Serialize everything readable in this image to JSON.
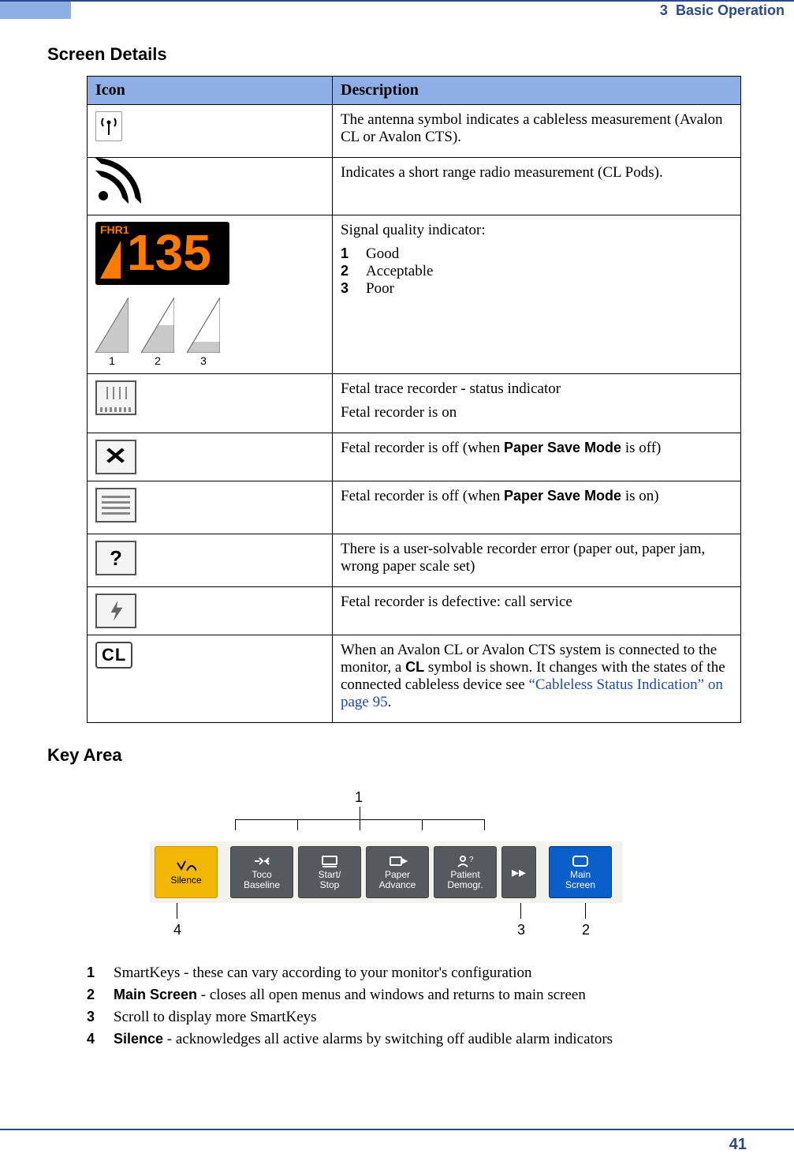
{
  "header": {
    "chapter": "3",
    "chapter_title": "Basic Operation"
  },
  "sections": {
    "screen_details": "Screen Details",
    "key_area": "Key Area"
  },
  "table": {
    "head": {
      "icon": "Icon",
      "desc": "Description"
    },
    "rows": {
      "antenna": "The antenna symbol indicates a cableless measurement (Avalon CL or Avalon CTS).",
      "rss": "Indicates a short range radio measurement (CL Pods).",
      "signal": {
        "title": "Signal quality indicator:",
        "items": {
          "1": "Good",
          "2": "Acceptable",
          "3": "Poor"
        },
        "fhr_label": "FHR1",
        "fhr_value": "135",
        "bar_labels": {
          "1": "1",
          "2": "2",
          "3": "3"
        }
      },
      "rec_on": {
        "l1": "Fetal trace recorder - status indicator",
        "l2": "Fetal recorder is on"
      },
      "rec_off_psm_off": {
        "pre": "Fetal recorder is off (when ",
        "code": "Paper Save Mode",
        "post": " is off)"
      },
      "rec_off_psm_on": {
        "pre": "Fetal recorder is off (when ",
        "code": "Paper Save Mode",
        "post": " is on)"
      },
      "rec_err": "There is a user-solvable recorder error (paper out, paper jam, wrong paper scale set)",
      "rec_def": "Fetal recorder is defective: call service",
      "cl": {
        "pre": "When an Avalon CL or Avalon CTS system is connected to the monitor, a ",
        "code": "CL",
        "mid": " symbol is shown. It changes with the states of the connected cableless device see ",
        "link": "“Cableless Status Indication” on page 95",
        "post": ".",
        "chip": "CL"
      }
    }
  },
  "keyarea": {
    "callouts": {
      "c1": "1",
      "c2": "2",
      "c3": "3",
      "c4": "4"
    },
    "keys": {
      "silence": "Silence",
      "toco": "Toco\nBaseline",
      "startstop": "Start/\nStop",
      "paper": "Paper\nAdvance",
      "patient": "Patient\nDemogr.",
      "main": "Main\nScreen"
    },
    "list": {
      "r1": {
        "n": "1",
        "t": "SmartKeys - these can vary according to your monitor's configuration"
      },
      "r2": {
        "n": "2",
        "code": "Main Screen",
        "t": " - closes all open menus and windows and returns to main screen"
      },
      "r3": {
        "n": "3",
        "t": "Scroll to display more SmartKeys"
      },
      "r4": {
        "n": "4",
        "code": "Silence",
        "t": " - acknowledges all active alarms by switching off audible alarm indicators"
      }
    }
  },
  "footer": {
    "page": "41"
  }
}
